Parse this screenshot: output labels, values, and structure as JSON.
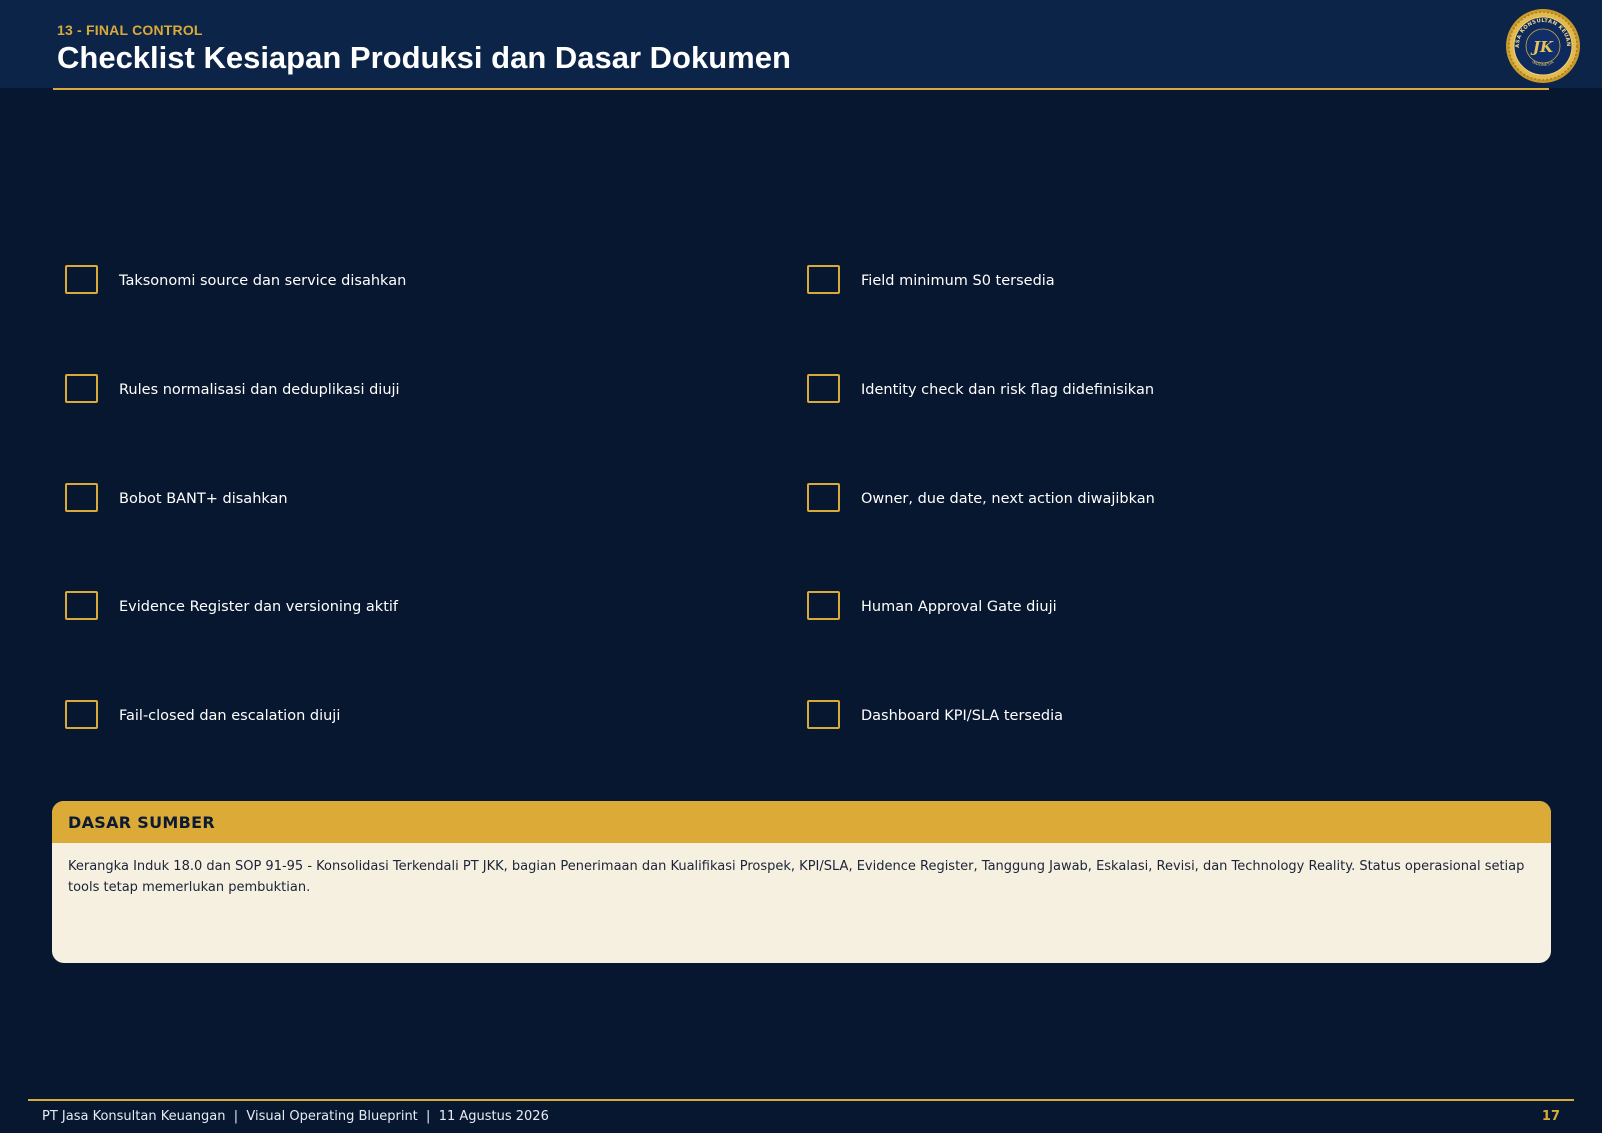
{
  "header": {
    "section_label": "13 - FINAL CONTROL",
    "title": "Checklist Kesiapan Produksi dan Dasar Dokumen",
    "logo_text": "PT JASA KONSULTAN KEUANGAN",
    "logo_subtext": "INDONESIA",
    "logo_monogram": "JK"
  },
  "checklist": {
    "left": [
      "Taksonomi source dan service disahkan",
      "Rules normalisasi dan deduplikasi diuji",
      "Bobot BANT+ disahkan",
      "Evidence Register dan versioning aktif",
      "Fail-closed dan escalation diuji"
    ],
    "right": [
      "Field minimum S0 tersedia",
      "Identity check dan risk flag didefinisikan",
      "Owner, due date, next action diwajibkan",
      "Human Approval Gate diuji",
      "Dashboard KPI/SLA tersedia"
    ]
  },
  "source_panel": {
    "title": "DASAR SUMBER",
    "body": "Kerangka Induk 18.0 dan SOP 91-95 - Konsolidasi Terkendali PT JKK, bagian Penerimaan dan Kualifikasi Prospek, KPI/SLA, Evidence Register, Tanggung Jawab, Eskalasi, Revisi, dan Technology Reality. Status operasional setiap tools tetap memerlukan pembuktian."
  },
  "footer": {
    "text": "PT Jasa Konsultan Keuangan  |  Visual Operating Blueprint  |  11 Agustus 2026",
    "page_number": "17"
  },
  "colors": {
    "background": "#081730",
    "header": "#0c2448",
    "accent_gold": "#d9a93a",
    "panel_header": "#dcaa37",
    "panel_body": "#f5f0df"
  }
}
